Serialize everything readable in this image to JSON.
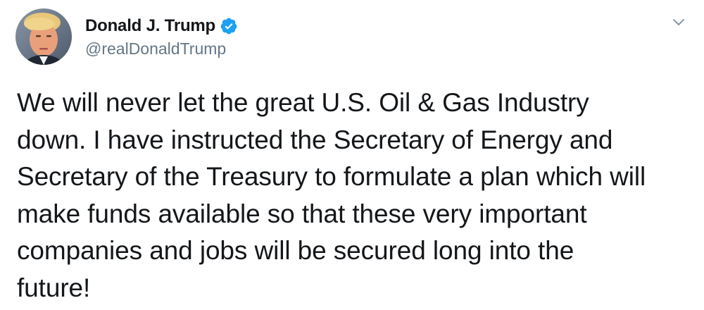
{
  "author": {
    "display_name": "Donald J. Trump",
    "handle": "@realDonaldTrump",
    "verified": true
  },
  "icons": {
    "verified": "verified-check-icon",
    "menu": "chevron-down-icon"
  },
  "colors": {
    "verified_blue": "#1da1f2",
    "handle_gray": "#657786",
    "text": "#14171a"
  },
  "tweet": {
    "lines": [
      "We will never let the great U.S. Oil & Gas Industry",
      "down. I have instructed the Secretary of Energy and",
      "Secretary of the Treasury to formulate a plan which will",
      "make funds available so that these very important",
      "companies and jobs will be secured long into the",
      "future!"
    ]
  }
}
